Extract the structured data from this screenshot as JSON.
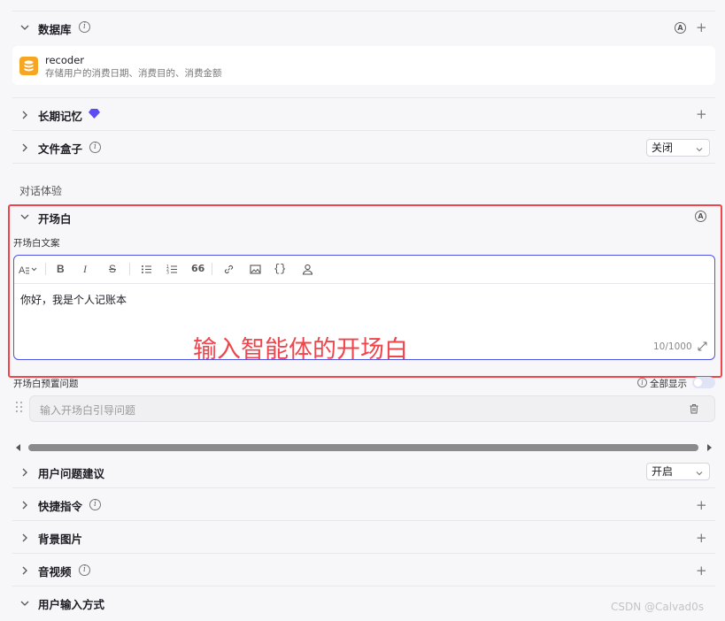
{
  "database": {
    "title": "数据库",
    "item": {
      "name": "recoder",
      "desc": "存储用户的消费日期、消费目的、消费金额"
    }
  },
  "long_memory": {
    "title": "长期记忆"
  },
  "file_box": {
    "title": "文件盒子",
    "select_value": "关闭"
  },
  "dialog_experience": {
    "heading": "对话体验"
  },
  "opening": {
    "title": "开场白",
    "copy_label": "开场白文案",
    "editor_text": "你好，我是个人记账本",
    "char_count": "10/1000",
    "annotation": "输入智能体的开场白",
    "preset_label": "开场白预置问题",
    "show_all_label": "全部显示",
    "question_placeholder": "输入开场白引导问题"
  },
  "user_suggestions": {
    "title": "用户问题建议",
    "select_value": "开启"
  },
  "shortcuts": {
    "title": "快捷指令"
  },
  "background_image": {
    "title": "背景图片"
  },
  "audio_video": {
    "title": "音视频"
  },
  "user_input": {
    "title": "用户输入方式"
  },
  "watermark": "CSDN @Calvad0s",
  "colors": {
    "accent": "#4d53e8",
    "annotation_red": "#f0454c",
    "db_icon": "#f5a623",
    "premium": "#5b4cf5"
  },
  "icons": [
    "chevron-down-icon",
    "chevron-right-icon",
    "info-icon",
    "plus-icon",
    "auto-icon",
    "database-icon",
    "premium-diamond-icon",
    "trash-icon",
    "drag-handle-icon",
    "expand-icon"
  ]
}
